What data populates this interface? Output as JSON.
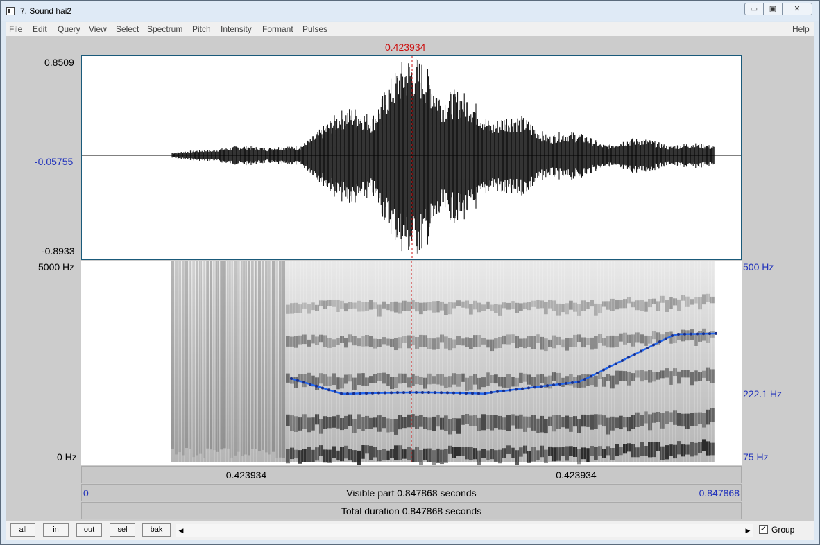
{
  "window": {
    "title": "7. Sound hai2",
    "min_glyph": "▭",
    "max_glyph": "▣",
    "close_glyph": "✕"
  },
  "menu": {
    "items": [
      "File",
      "Edit",
      "Query",
      "View",
      "Select",
      "Spectrum",
      "Pitch",
      "Intensity",
      "Formant",
      "Pulses"
    ],
    "help": "Help"
  },
  "cursor": {
    "time_label": "0.423934",
    "time": 0.423934,
    "color": "#cc1111"
  },
  "waveform": {
    "amp_max": "0.8509",
    "amp_mid": "-0.05755",
    "amp_min": "-0.8933"
  },
  "spectrogram": {
    "freq_max": "5000 Hz",
    "freq_min": "0 Hz"
  },
  "pitch": {
    "ceiling_label": "500 Hz",
    "mid_label": "222.1 Hz",
    "floor_label": "75 Hz",
    "color": "#2266ee"
  },
  "selection_bar": {
    "left": "0.423934",
    "right": "0.423934"
  },
  "visible_bar": {
    "start": "0",
    "text": "Visible part 0.847868 seconds",
    "end": "0.847868"
  },
  "total_bar": {
    "text": "Total duration 0.847868 seconds"
  },
  "buttons": {
    "all": "all",
    "in": "in",
    "out": "out",
    "sel": "sel",
    "bak": "bak"
  },
  "scroll": {
    "left_glyph": "◀",
    "right_glyph": "▶"
  },
  "group": {
    "label": "Group",
    "checked": true,
    "check_glyph": "✓"
  }
}
